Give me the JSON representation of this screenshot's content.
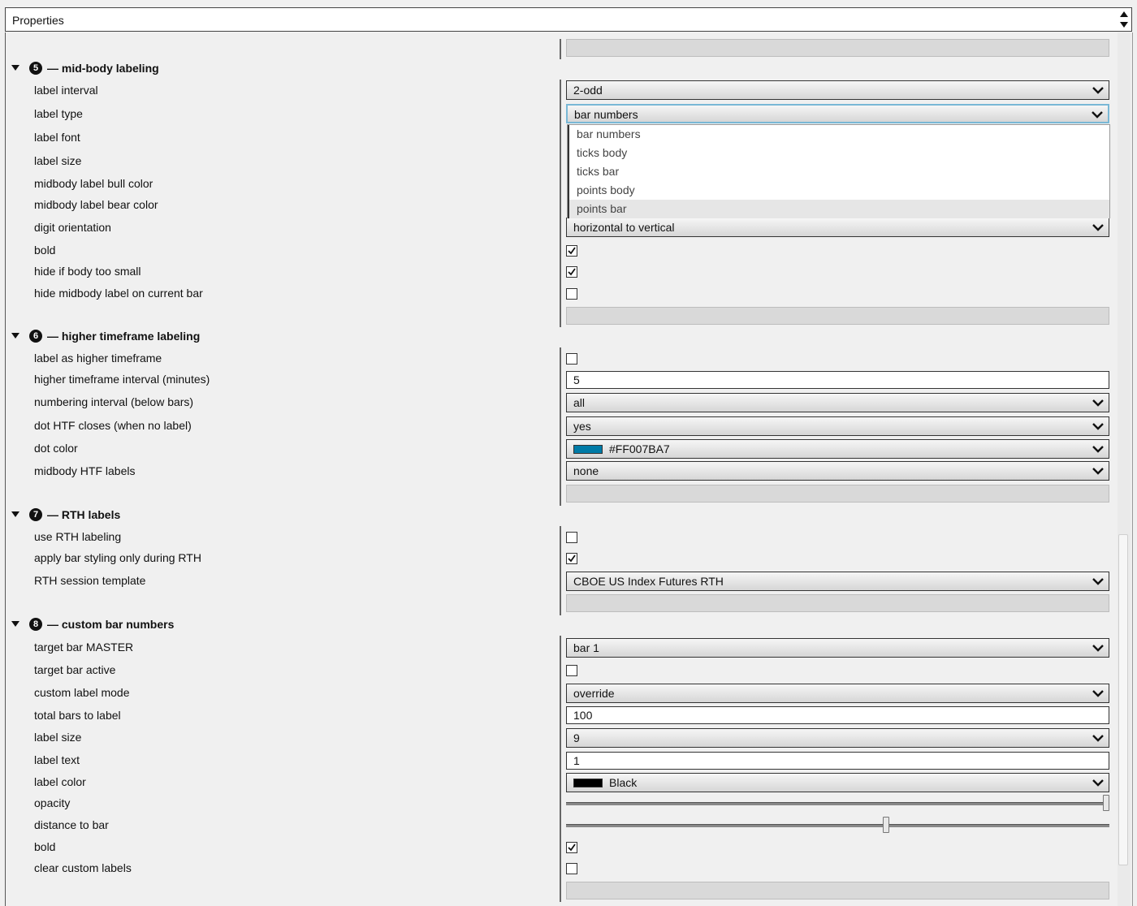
{
  "window": {
    "title": "Properties"
  },
  "sections": [
    {
      "number": "5",
      "title": "— mid-body labeling",
      "rows": [
        {
          "label": "label interval",
          "value": "2-odd"
        },
        {
          "label": "label type",
          "value": "bar numbers"
        },
        {
          "label": "label font"
        },
        {
          "label": "label size"
        },
        {
          "label": "midbody label bull color"
        },
        {
          "label": "midbody label bear color"
        },
        {
          "label": "digit orientation",
          "value": "horizontal to vertical"
        },
        {
          "label": "bold",
          "checked": true
        },
        {
          "label": "hide if body too small",
          "checked": true
        },
        {
          "label": "hide midbody label on current bar",
          "checked": false
        }
      ]
    },
    {
      "number": "6",
      "title": "— higher timeframe labeling",
      "rows": [
        {
          "label": "label as higher timeframe",
          "checked": false
        },
        {
          "label": "higher timeframe interval (minutes)",
          "value": "5"
        },
        {
          "label": "numbering interval (below bars)",
          "value": "all"
        },
        {
          "label": "dot HTF closes (when no label)",
          "value": "yes"
        },
        {
          "label": "dot color",
          "value": "#FF007BA7",
          "color": "#007BA7"
        },
        {
          "label": "midbody HTF labels",
          "value": "none"
        }
      ]
    },
    {
      "number": "7",
      "title": "— RTH labels",
      "rows": [
        {
          "label": "use RTH labeling",
          "checked": false
        },
        {
          "label": "apply bar styling only during RTH",
          "checked": true
        },
        {
          "label": "RTH session template",
          "value": "CBOE US Index Futures RTH"
        }
      ]
    },
    {
      "number": "8",
      "title": "— custom bar numbers",
      "rows": [
        {
          "label": "target bar MASTER",
          "value": "bar 1"
        },
        {
          "label": "target bar active",
          "checked": false
        },
        {
          "label": "custom label mode",
          "value": "override"
        },
        {
          "label": "total bars to label",
          "value": "100"
        },
        {
          "label": "label size",
          "value": "9"
        },
        {
          "label": "label text",
          "value": "1"
        },
        {
          "label": "label color",
          "value": "Black",
          "color": "#000000"
        },
        {
          "label": "opacity",
          "level_percent": 100
        },
        {
          "label": "distance to bar",
          "level_percent": 59
        },
        {
          "label": "bold",
          "checked": true
        },
        {
          "label": "clear custom labels",
          "checked": false
        }
      ]
    }
  ],
  "label_type_dropdown": {
    "options": [
      "bar numbers",
      "ticks body",
      "ticks bar",
      "points body",
      "points bar"
    ],
    "highlighted": "points bar"
  }
}
